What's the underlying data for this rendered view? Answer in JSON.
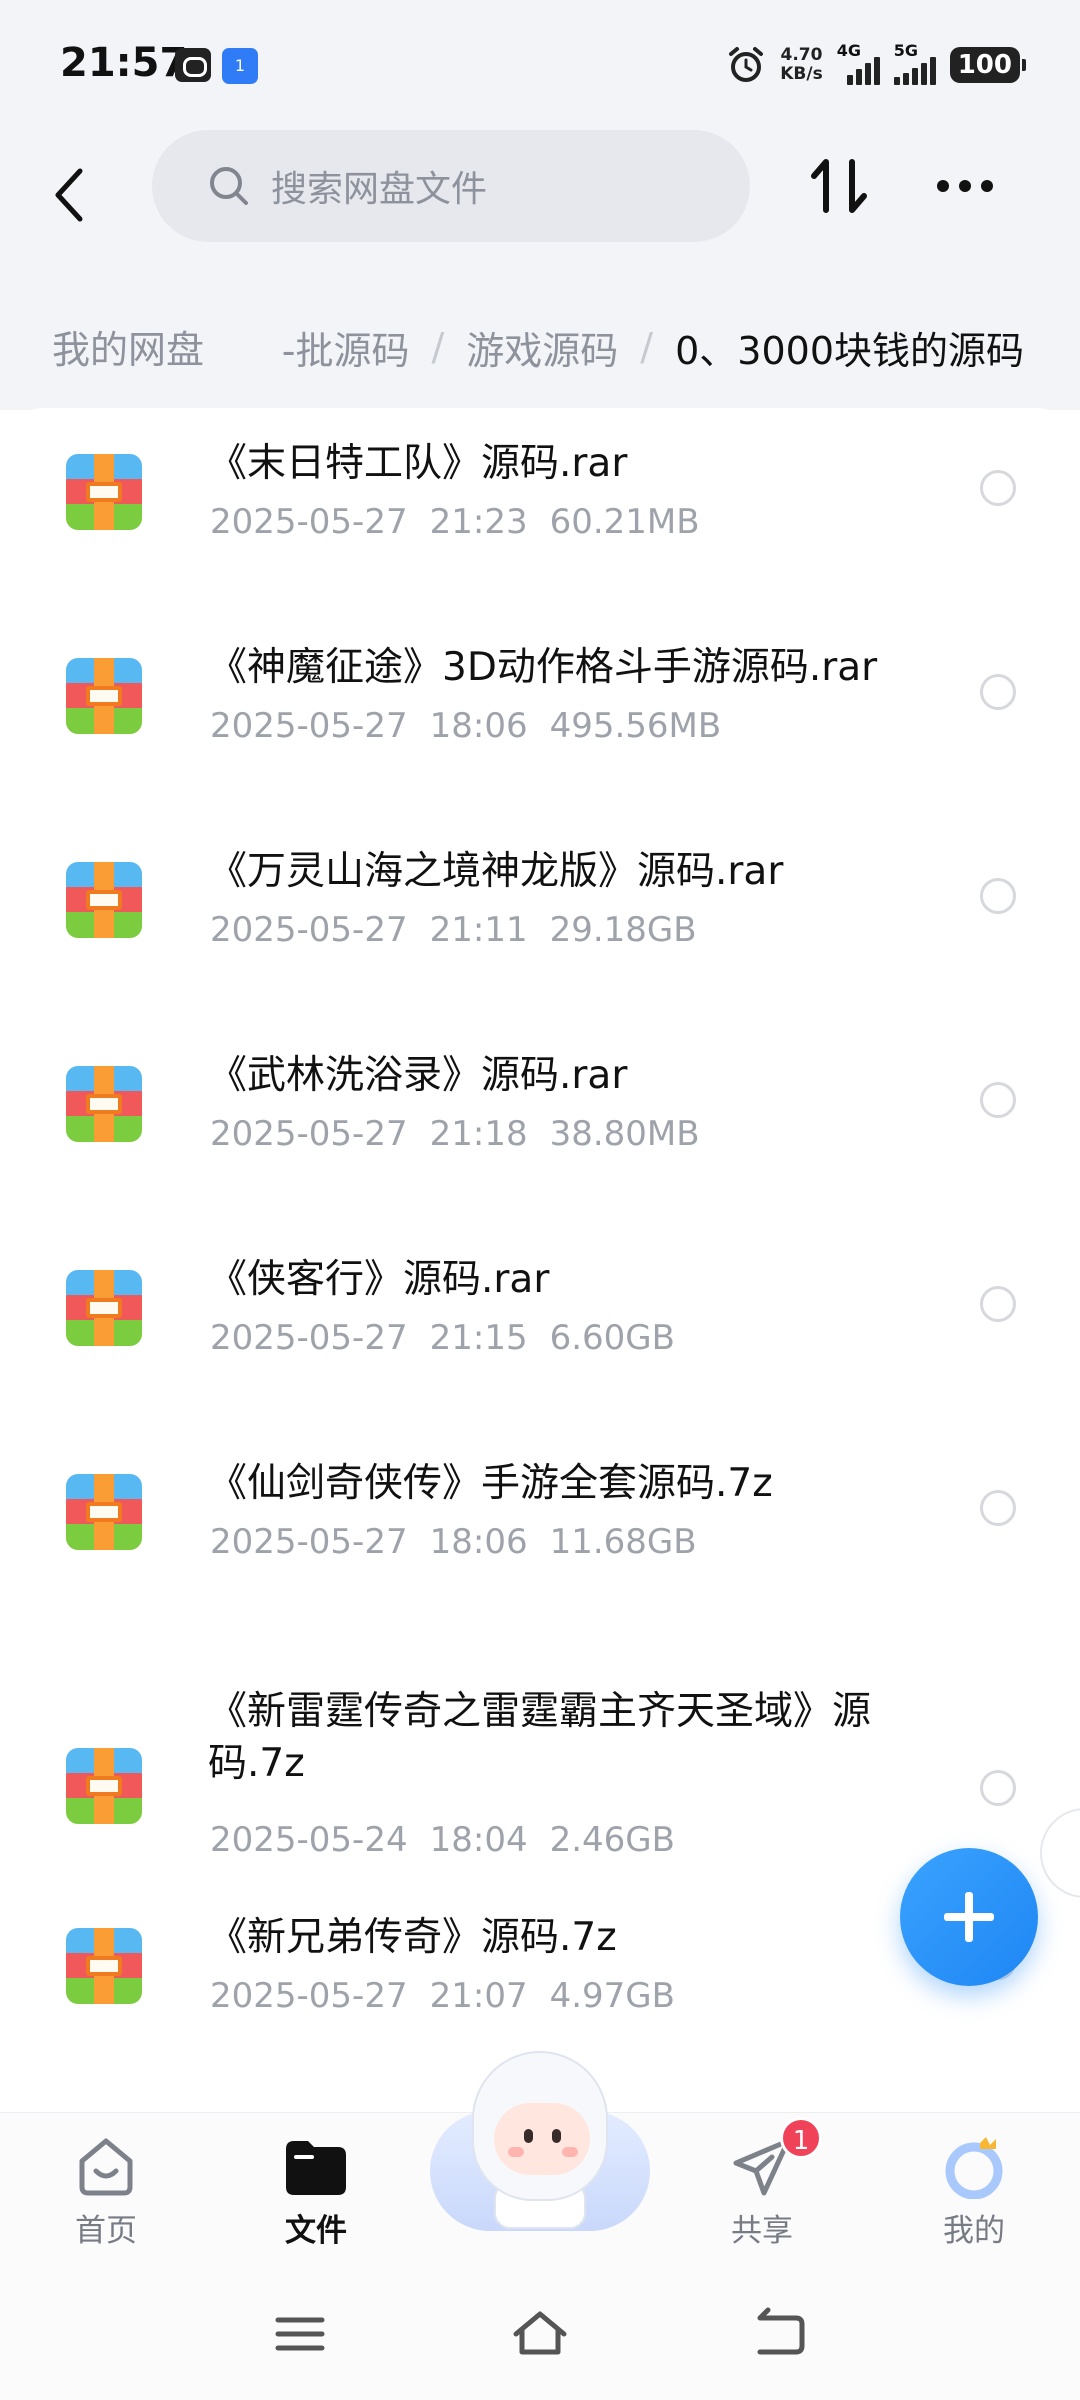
{
  "status_bar": {
    "time": "21:57",
    "net_speed_value": "4.70",
    "net_speed_unit": "KB/s",
    "signal1_label": "4G",
    "signal2_label": "5G",
    "battery": "100",
    "app2_badge": "1"
  },
  "header": {
    "search_placeholder": "搜索网盘文件"
  },
  "breadcrumb": {
    "root": "我的网盘",
    "items": [
      "-批源码",
      "游戏源码"
    ],
    "current": "0、3000块钱的源码"
  },
  "files": [
    {
      "name": "《末日特工队》源码.rar",
      "date": "2025-05-27",
      "time": "21:23",
      "size": "60.21MB"
    },
    {
      "name": "《神魔征途》3D动作格斗手游源码.rar",
      "date": "2025-05-27",
      "time": "18:06",
      "size": "495.56MB"
    },
    {
      "name": "《万灵山海之境神龙版》源码.rar",
      "date": "2025-05-27",
      "time": "21:11",
      "size": "29.18GB"
    },
    {
      "name": "《武林洗浴录》源码.rar",
      "date": "2025-05-27",
      "time": "21:18",
      "size": "38.80MB"
    },
    {
      "name": "《侠客行》源码.rar",
      "date": "2025-05-27",
      "time": "21:15",
      "size": "6.60GB"
    },
    {
      "name": "《仙剑奇侠传》手游全套源码.7z",
      "date": "2025-05-27",
      "time": "18:06",
      "size": "11.68GB"
    },
    {
      "name": "《新雷霆传奇之雷霆霸主齐天圣域》源码.7z",
      "date": "2025-05-24",
      "time": "18:04",
      "size": "2.46GB"
    },
    {
      "name": "《新兄弟传奇》源码.7z",
      "date": "2025-05-27",
      "time": "21:07",
      "size": "4.97GB"
    }
  ],
  "bottom_nav": {
    "items": [
      {
        "label": "首页",
        "icon": "home-icon"
      },
      {
        "label": "文件",
        "icon": "folder-icon",
        "active": true
      },
      {
        "label": "共享",
        "icon": "share-icon",
        "badge": "1"
      },
      {
        "label": "我的",
        "icon": "profile-icon"
      }
    ]
  },
  "colors": {
    "accent": "#1e86f3",
    "badge": "#f0435a",
    "background": "#f3f4f7"
  }
}
